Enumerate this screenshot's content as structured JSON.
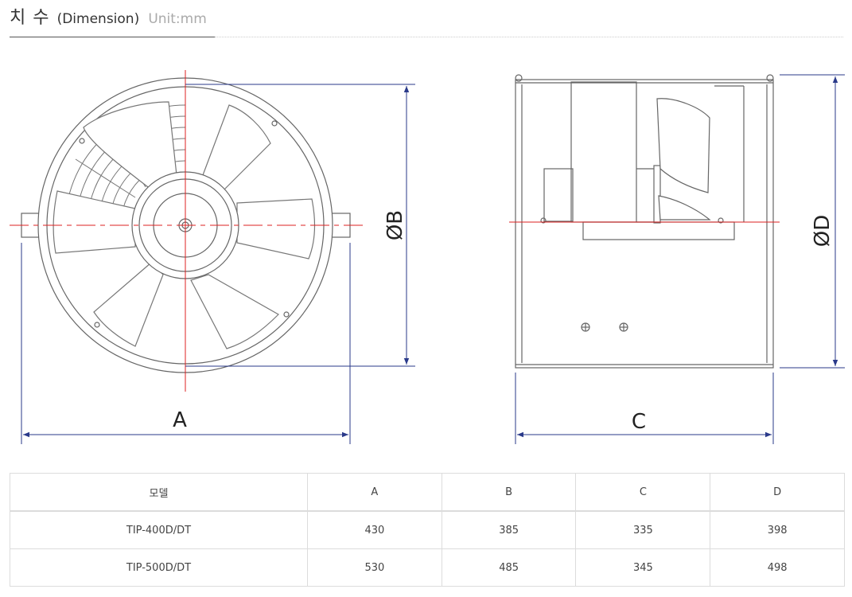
{
  "heading": {
    "title_ko": "치 수",
    "title_en": "(Dimension)",
    "unit": "Unit:mm"
  },
  "drawing": {
    "front_labels": {
      "width": "A",
      "diameter": "ØB"
    },
    "side_labels": {
      "length": "C",
      "diameter": "ØD"
    }
  },
  "table": {
    "headers": [
      "모델",
      "A",
      "B",
      "C",
      "D"
    ],
    "rows": [
      [
        "TIP-400D/DT",
        "430",
        "385",
        "335",
        "398"
      ],
      [
        "TIP-500D/DT",
        "530",
        "485",
        "345",
        "498"
      ]
    ]
  }
}
